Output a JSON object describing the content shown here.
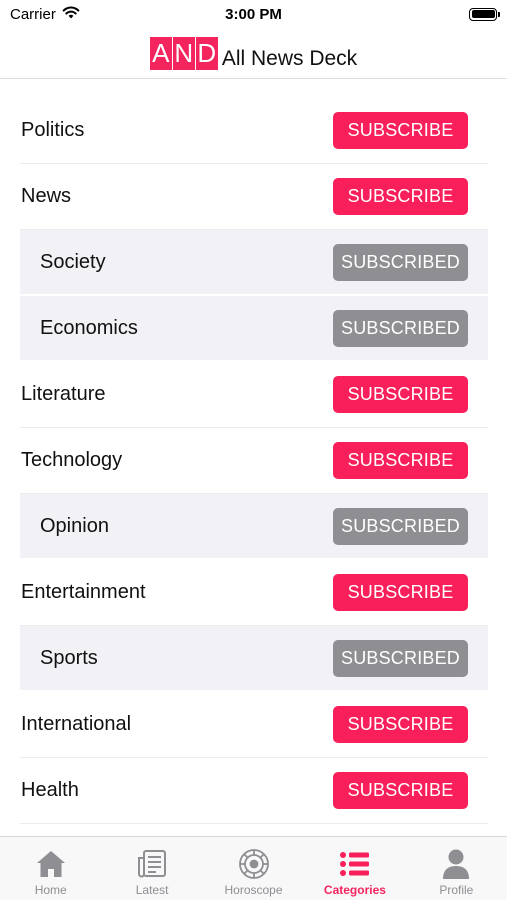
{
  "status": {
    "carrier": "Carrier",
    "time": "3:00 PM",
    "battery_level": 1.0
  },
  "header": {
    "logo_letters": [
      "A",
      "N",
      "D"
    ],
    "title": "All News Deck"
  },
  "categories": [
    {
      "label": "Politics",
      "button": "SUBSCRIBE",
      "state": "subscribe",
      "indent": false
    },
    {
      "label": "News",
      "button": "SUBSCRIBE",
      "state": "subscribe",
      "indent": false
    },
    {
      "label": "Society",
      "button": "SUBSCRIBED",
      "state": "subscribed",
      "indent": true
    },
    {
      "label": "Economics",
      "button": "SUBSCRIBED",
      "state": "subscribed",
      "indent": true
    },
    {
      "label": "Literature",
      "button": "SUBSCRIBE",
      "state": "subscribe",
      "indent": false
    },
    {
      "label": "Technology",
      "button": "SUBSCRIBE",
      "state": "subscribe",
      "indent": false
    },
    {
      "label": "Opinion",
      "button": "SUBSCRIBED",
      "state": "subscribed",
      "indent": true
    },
    {
      "label": "Entertainment",
      "button": "SUBSCRIBE",
      "state": "subscribe",
      "indent": false
    },
    {
      "label": "Sports",
      "button": "SUBSCRIBED",
      "state": "subscribed",
      "indent": true
    },
    {
      "label": "International",
      "button": "SUBSCRIBE",
      "state": "subscribe",
      "indent": false
    },
    {
      "label": "Health",
      "button": "SUBSCRIBE",
      "state": "subscribe",
      "indent": false
    }
  ],
  "tabbar": {
    "active": "Categories",
    "tabs": [
      {
        "label": "Home",
        "icon": "home-icon"
      },
      {
        "label": "Latest",
        "icon": "newspaper-icon"
      },
      {
        "label": "Horoscope",
        "icon": "zodiac-wheel-icon"
      },
      {
        "label": "Categories",
        "icon": "list-icon"
      },
      {
        "label": "Profile",
        "icon": "person-icon"
      }
    ]
  },
  "colors": {
    "accent": "#f81f5a",
    "subscribed_gray": "#8e8e93",
    "tab_inactive": "#8e8e93",
    "sub_row_bg": "#f1f1f6"
  }
}
